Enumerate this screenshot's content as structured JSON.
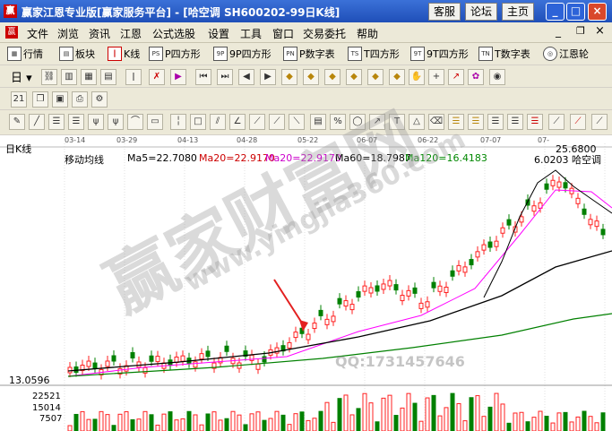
{
  "window": {
    "title": "赢家江恩专业版[赢家服务平台] - [哈空调   SH600202-99日K线]",
    "buttons": [
      "客服",
      "论坛",
      "主页"
    ]
  },
  "menu": [
    "文件",
    "浏览",
    "资讯",
    "江恩",
    "公式选股",
    "设置",
    "工具",
    "窗口",
    "交易委托",
    "帮助"
  ],
  "toolbar1": [
    {
      "icon": "grid-icon",
      "label": "行情"
    },
    {
      "icon": "blocks-icon",
      "label": "板块"
    },
    {
      "icon": "candle-icon",
      "label": "K线"
    },
    {
      "icon": "ps-icon",
      "label": "P四方形"
    },
    {
      "icon": "9ps-icon",
      "label": "9P四方形"
    },
    {
      "icon": "pn-icon",
      "label": "P数字表"
    },
    {
      "icon": "ts-icon",
      "label": "T四方形"
    },
    {
      "icon": "9ts-icon",
      "label": "9T四方形"
    },
    {
      "icon": "tn-icon",
      "label": "T数字表"
    },
    {
      "icon": "wheel-icon",
      "label": "江恩轮"
    }
  ],
  "chart": {
    "period": "日K线",
    "indicator": "移动均线",
    "ma5": "Ma5=22.7080",
    "ma20a": "Ma20=22.9170",
    "ma20b": "Ma20=22.9170",
    "ma60": "Ma60=18.7987",
    "ma120": "Ma120=16.4183",
    "high_label": "25.6800",
    "stock_label": "6.0203 哈空调",
    "low_price": "13.0596",
    "volume_ticks": [
      "22521",
      "15014",
      "7507"
    ],
    "dates": [
      "03-14",
      "03-29",
      "04-13",
      "04-28",
      "05-22",
      "06-07",
      "06-22",
      "07-07",
      "07-"
    ]
  },
  "watermark": {
    "big": "赢家财富网",
    "url": "www.yingjia360.com",
    "qq": "QQ:1731457646"
  },
  "colors": {
    "up": "#ff2020",
    "down": "#008000",
    "ma5": "#000000",
    "ma20": "#ff00ff",
    "ma60": "#000000",
    "ma120": "#008000",
    "title": "#1f4fb8"
  }
}
